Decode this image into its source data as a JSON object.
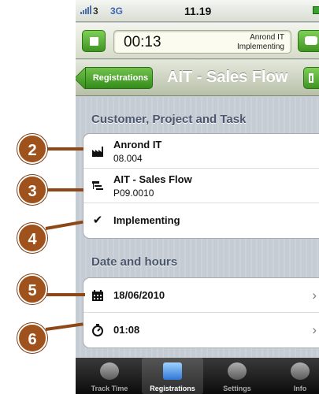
{
  "status_bar": {
    "carrier": "3",
    "network": "3G",
    "time": "11.19"
  },
  "timer": {
    "elapsed": "00:13",
    "customer": "Anrond IT",
    "task": "Implementing"
  },
  "nav": {
    "back_label": "Registrations",
    "title": "AIT - Sales Flow"
  },
  "section_task": {
    "header": "Customer, Project and Task",
    "rows": [
      {
        "icon": "factory-icon",
        "title": "Anrond IT",
        "subtitle": "08.004"
      },
      {
        "icon": "hierarchy-icon",
        "title": "AIT - Sales Flow",
        "subtitle": "P09.0010"
      },
      {
        "icon": "checkmark-icon",
        "title": "Implementing"
      }
    ]
  },
  "section_date": {
    "header": "Date and hours",
    "rows": [
      {
        "icon": "calendar-icon",
        "value": "18/06/2010",
        "chevron": "›"
      },
      {
        "icon": "stopwatch-icon",
        "value": "01:08",
        "chevron": "›"
      }
    ]
  },
  "tabs": [
    {
      "label": "Track Time",
      "icon": "stopwatch-icon",
      "active": false
    },
    {
      "label": "Registrations",
      "icon": "tray-icon",
      "active": true
    },
    {
      "label": "Settings",
      "icon": "gear-icon",
      "active": false
    },
    {
      "label": "Info",
      "icon": "info-icon",
      "active": false
    }
  ],
  "callouts": [
    "2",
    "3",
    "4",
    "5",
    "6"
  ],
  "colors": {
    "accent_green": "#3f9522",
    "callout_brown": "#a0521d",
    "section_text": "#4c566c"
  }
}
